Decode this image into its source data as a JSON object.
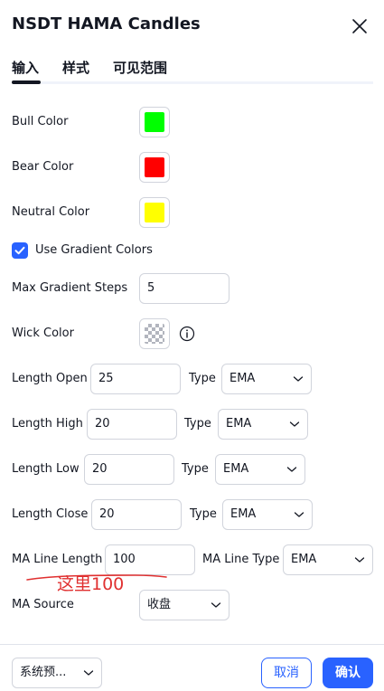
{
  "dialog": {
    "title": "NSDT HAMA Candles"
  },
  "tabs": [
    {
      "label": "输入",
      "active": true
    },
    {
      "label": "样式",
      "active": false
    },
    {
      "label": "可见范围",
      "active": false
    }
  ],
  "colors": {
    "accent": "#2962ff",
    "bull": "#00ff00",
    "bear": "#ff0000",
    "neutral": "#ffff00",
    "annotation": "#e03030"
  },
  "inputs": {
    "bull_color_label": "Bull Color",
    "bear_color_label": "Bear Color",
    "neutral_color_label": "Neutral Color",
    "use_gradient_label": "Use Gradient Colors",
    "use_gradient_checked": true,
    "max_gradient_label": "Max Gradient Steps",
    "max_gradient_value": "5",
    "wick_color_label": "Wick Color",
    "wick_color_swatch": "transparent-checker",
    "type_label": "Type",
    "length_open_label": "Length Open",
    "length_open_value": "25",
    "length_open_type": "EMA",
    "length_high_label": "Length High",
    "length_high_value": "20",
    "length_high_type": "EMA",
    "length_low_label": "Length Low",
    "length_low_value": "20",
    "length_low_type": "EMA",
    "length_close_label": "Length Close",
    "length_close_value": "20",
    "length_close_type": "EMA",
    "ma_line_length_label": "MA Line Length",
    "ma_line_length_value": "100",
    "ma_line_type_label": "MA Line Type",
    "ma_line_type_value": "EMA",
    "ma_source_label": "MA Source",
    "ma_source_value": "收盘"
  },
  "annotation": {
    "text": "这里100"
  },
  "footer": {
    "preset_label": "系统预...",
    "cancel_label": "取消",
    "ok_label": "确认"
  }
}
